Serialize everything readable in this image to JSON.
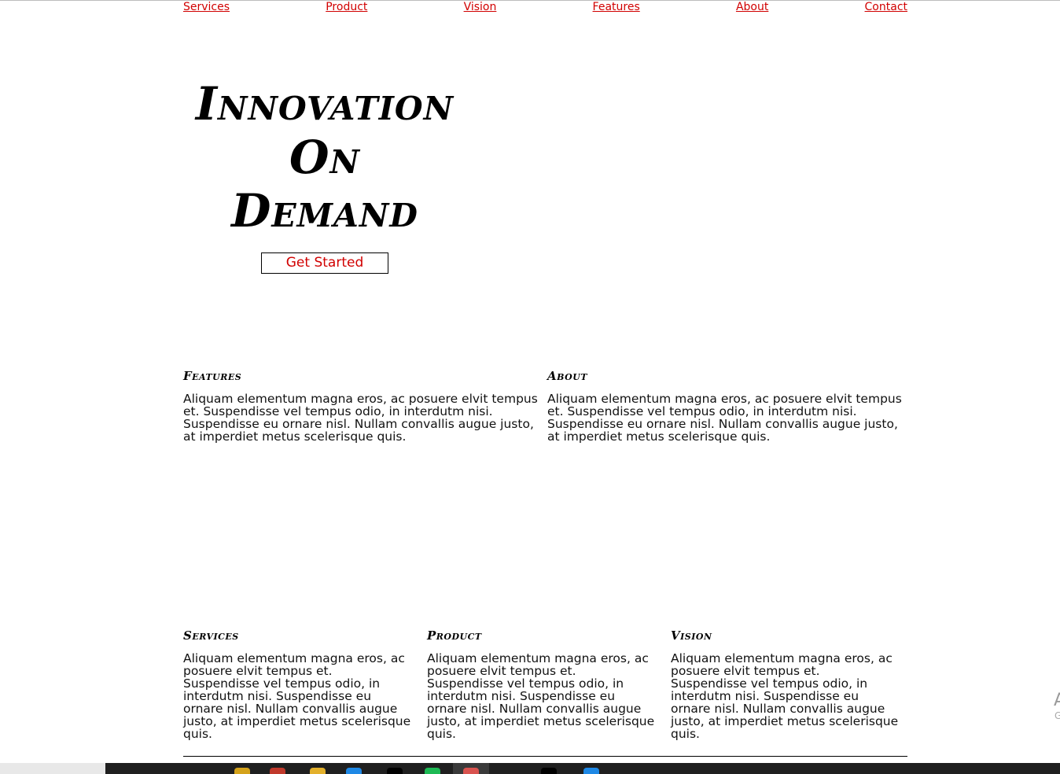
{
  "nav": {
    "items": [
      {
        "label": "Services"
      },
      {
        "label": "Product"
      },
      {
        "label": "Vision"
      },
      {
        "label": "Features"
      },
      {
        "label": "About"
      },
      {
        "label": "Contact"
      }
    ]
  },
  "hero": {
    "title_line1": "Innovation",
    "title_line2": "On",
    "title_line3": "Demand",
    "cta_label": "Get Started"
  },
  "sections": {
    "features": {
      "heading": "Features",
      "body": "Aliquam elementum magna eros, ac posuere elvit tempus et. Suspendisse vel tempus odio, in interdutm nisi. Suspendisse eu ornare nisl. Nullam convallis augue justo, at imperdiet metus scelerisque quis."
    },
    "about": {
      "heading": "About",
      "body": "Aliquam elementum magna eros, ac posuere elvit tempus et. Suspendisse vel tempus odio, in interdutm nisi. Suspendisse eu ornare nisl. Nullam convallis augue justo, at imperdiet metus scelerisque quis."
    },
    "services": {
      "heading": "Services",
      "body": "Aliquam elementum magna eros, ac posuere elvit tempus et. Suspendisse vel tempus odio, in interdutm nisi. Suspendisse eu ornare nisl. Nullam convallis augue justo, at imperdiet metus scelerisque quis."
    },
    "product": {
      "heading": "Product",
      "body": "Aliquam elementum magna eros, ac posuere elvit tempus et. Suspendisse vel tempus odio, in interdutm nisi. Suspendisse eu ornare nisl. Nullam convallis augue justo, at imperdiet metus scelerisque quis."
    },
    "vision": {
      "heading": "Vision",
      "body": "Aliquam elementum magna eros, ac posuere elvit tempus et. Suspendisse vel tempus odio, in interdutm nisi. Suspendisse eu ornare nisl. Nullam convallis augue justo, at imperdiet metus scelerisque quis."
    }
  },
  "colors": {
    "link": "#d10000",
    "text": "#111111",
    "taskbar": "#1f1f1f"
  }
}
